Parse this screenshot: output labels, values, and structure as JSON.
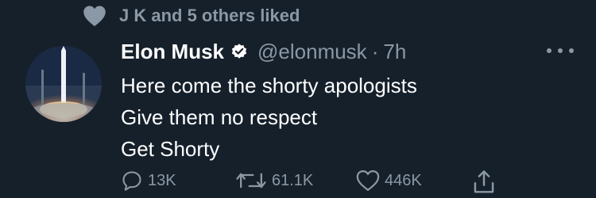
{
  "social_context": {
    "liked_text": "J K and 5 others liked"
  },
  "tweet": {
    "author_name": "Elon Musk",
    "handle": "@elonmusk",
    "separator": "·",
    "time": "7h",
    "lines": [
      "Here come the shorty apologists",
      "Give them no respect",
      "Get Shorty"
    ]
  },
  "actions": {
    "reply_count": "13K",
    "retweet_count": "61.1K",
    "like_count": "446K"
  },
  "icons": {
    "liked_heart": "heart-icon",
    "verified": "verified-badge-icon",
    "more": "more-icon",
    "reply": "reply-icon",
    "retweet": "retweet-icon",
    "like": "like-icon",
    "share": "share-icon"
  },
  "colors": {
    "background": "#15202b",
    "muted": "#8b98a5",
    "text": "#ffffff"
  }
}
